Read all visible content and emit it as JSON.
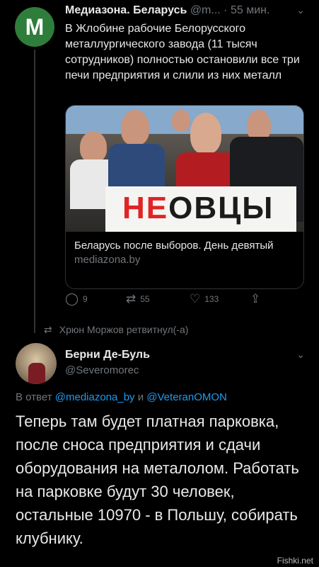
{
  "tweet1": {
    "avatar_letter": "M",
    "name": "Медиазона. Беларусь",
    "handle": "@m...",
    "time": "· 55 мин.",
    "text": "В Жлобине рабочие Белорусского металлургического завода (11 тысяч сотрудников) полностью остановили все три печи предприятия и слили из них металл",
    "card": {
      "image_banner_red": "НЕ",
      "image_banner_dark": "ОВЦЫ",
      "title": "Беларусь после выборов. День девятый",
      "domain": "mediazona.by"
    },
    "actions": {
      "replies": "9",
      "retweets": "55",
      "likes": "133"
    }
  },
  "retweet_label": "Хрюн Моржов ретвитнул(-а)",
  "tweet2": {
    "name": "Берни Де-Буль",
    "handle": "@Severomorec",
    "reply_prefix": "В ответ",
    "reply_user1": "@mediazona_by",
    "reply_and": "и",
    "reply_user2": "@VeteranOMON",
    "text": "Теперь там будет платная парковка, после сноса предприятия и сдачи оборудования на металолом. Работать на парковке будут 30 человек, остальные 10970 - в Польшу, собирать клубнику."
  },
  "watermark": "Fishki.net",
  "icons": {
    "reply": "comment-icon",
    "retweet": "retweet-icon",
    "like": "heart-icon",
    "share": "share-icon",
    "more": "chevron-down-icon"
  }
}
